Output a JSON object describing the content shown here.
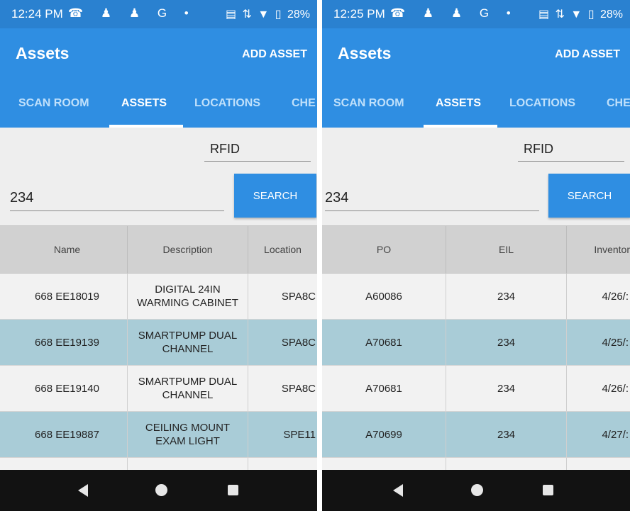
{
  "left": {
    "status": {
      "time": "12:24 PM",
      "icons": "☎ ♟ ♟ G •",
      "indicators": [
        "▤",
        "⇅",
        "▼",
        "▯"
      ],
      "battery": "28%"
    },
    "appbar": {
      "title": "Assets",
      "add_asset": "ADD ASSET"
    },
    "tabs": [
      "SCAN ROOM",
      "ASSETS",
      "LOCATIONS",
      "CHE"
    ],
    "rfid": "RFID",
    "search": {
      "value": "234",
      "button": "SEARCH"
    },
    "table": {
      "headers": [
        "Name",
        "Description",
        "Location"
      ],
      "rows": [
        {
          "name": "668 EE18019",
          "description": "DIGITAL 24IN WARMING CABINET",
          "location": "SPA8C"
        },
        {
          "name": "668 EE19139",
          "description": "SMARTPUMP DUAL CHANNEL",
          "location": "SPA8C"
        },
        {
          "name": "668 EE19140",
          "description": "SMARTPUMP DUAL CHANNEL",
          "location": "SPA8C"
        },
        {
          "name": "668 EE19887",
          "description": "CEILING MOUNT EXAM LIGHT",
          "location": "SPE11"
        }
      ]
    }
  },
  "right": {
    "status": {
      "time": "12:25 PM",
      "icons": "☎ ♟ ♟ G •",
      "indicators": [
        "▤",
        "⇅",
        "▼",
        "▯"
      ],
      "battery": "28%"
    },
    "appbar": {
      "title": "Assets",
      "add_asset": "ADD ASSET"
    },
    "tabs": [
      "SCAN ROOM",
      "ASSETS",
      "LOCATIONS",
      "CHE"
    ],
    "rfid": "RFID",
    "search": {
      "value": "234",
      "button": "SEARCH"
    },
    "table": {
      "headers": [
        "PO",
        "EIL",
        "Inventor"
      ],
      "rows": [
        {
          "po": "A60086",
          "eil": "234",
          "inventory": "4/26/:"
        },
        {
          "po": "A70681",
          "eil": "234",
          "inventory": "4/25/:"
        },
        {
          "po": "A70681",
          "eil": "234",
          "inventory": "4/26/:"
        },
        {
          "po": "A70699",
          "eil": "234",
          "inventory": "4/27/:"
        }
      ]
    }
  }
}
